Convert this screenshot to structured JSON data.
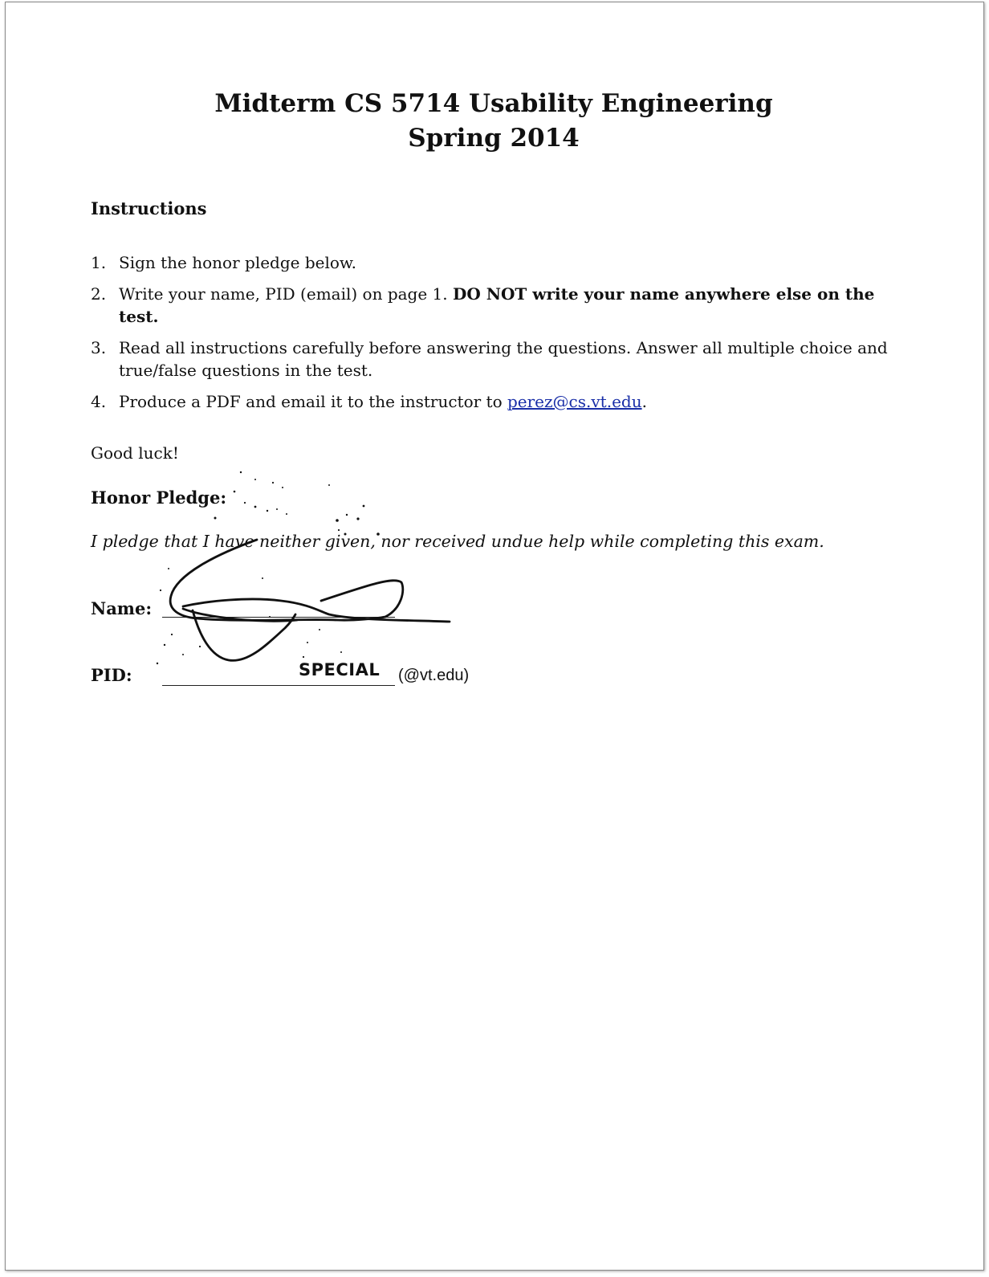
{
  "document": {
    "title_line1": "Midterm CS 5714 Usability Engineering",
    "title_line2": "Spring 2014",
    "instructions_heading": "Instructions",
    "instructions": [
      {
        "num": "1.",
        "text": "Sign the honor pledge below."
      },
      {
        "num": "2.",
        "text": "Write your name, PID (email) on page 1. ",
        "bold_text": "DO NOT write your name anywhere else on the test."
      },
      {
        "num": "3.",
        "text": "Read all instructions carefully before answering the questions. Answer all multiple choice and true/false questions in the test."
      },
      {
        "num": "4.",
        "text_before": "Produce a PDF and email it to the instructor to ",
        "link": "perez@cs.vt.edu",
        "text_after": "."
      }
    ],
    "good_luck": "Good luck!",
    "honor_pledge_label": "Honor Pledge:",
    "pledge_text": "I pledge that I have neither given, nor received undue help while completing this exam.",
    "name_label": "Name:",
    "pid_label": "PID:",
    "pid_value": "SPECIAL",
    "pid_suffix": "(@vt.edu)"
  },
  "colors": {
    "link": "#1a2fa8",
    "text": "#111111",
    "ink": "#111111"
  }
}
